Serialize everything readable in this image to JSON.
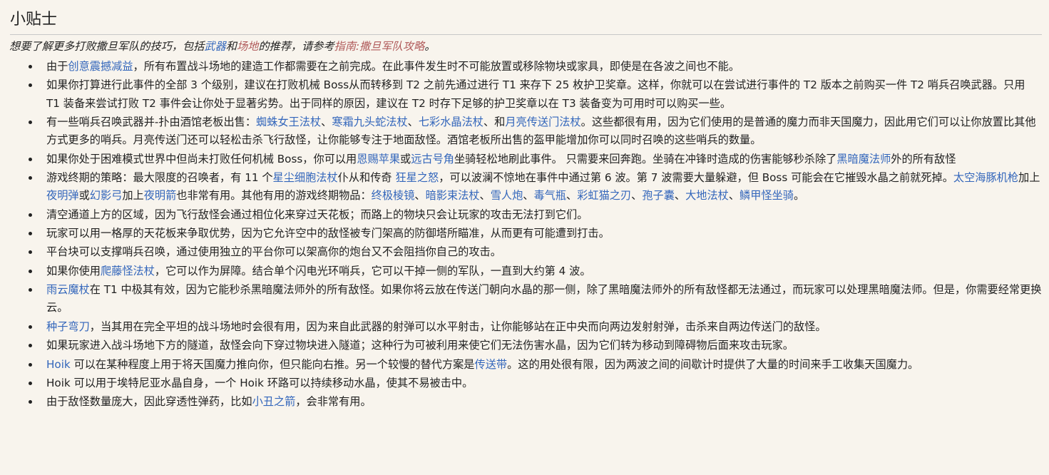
{
  "section": {
    "title": "小贴士"
  },
  "hatnote": {
    "prefix": "想要了解更多打败撒旦军队的技巧，包括",
    "link_weapons": "武器",
    "and": "和",
    "link_arenas": "场地",
    "middle": "的推荐，请参考",
    "link_guide": "指南:撒旦军队攻略",
    "suffix": "。"
  },
  "tips": [
    {
      "parts": [
        {
          "t": "由于"
        },
        {
          "t": "创意震撼减益",
          "link": true
        },
        {
          "t": "，所有布置战斗场地的建造工作都需要在之前完成。在此事件发生时不可能放置或移除物块或家具，即使是在各波之间也不能。"
        }
      ]
    },
    {
      "parts": [
        {
          "t": "如果你打算进行此事件的全部 3 个级别，建议在打败机械 Boss从而转移到 T2 之前先通过进行 T1 来存下 25 枚护卫奖章。这样，你就可以在尝试进行事件的 T2 版本之前购买一件 T2 哨兵召唤武器。只用 T1 装备来尝试打败 T2 事件会让你处于显著劣势。出于同样的原因，建议在 T2 时存下足够的护卫奖章以在 T3 装备变为可用时可以购买一些。"
        }
      ]
    },
    {
      "parts": [
        {
          "t": "有一些哨兵召唤武器并-扑由酒馆老板出售："
        },
        {
          "t": "蜘蛛女王法杖",
          "link": true
        },
        {
          "t": "、"
        },
        {
          "t": "寒霜九头蛇法杖",
          "link": true
        },
        {
          "t": "、"
        },
        {
          "t": "七彩水晶法杖",
          "link": true
        },
        {
          "t": "、和"
        },
        {
          "t": "月亮传送门法杖",
          "link": true
        },
        {
          "t": "。这些都很有用，因为它们使用的是普通的魔力而非天国魔力，因此用它们可以让你放置比其他方式更多的哨兵。月亮传送门还可以轻松击杀飞行敌怪，让你能够专注于地面敌怪。酒馆老板所出售的盔甲能增加你可以同时召唤的这些哨兵的数量。"
        }
      ]
    },
    {
      "parts": [
        {
          "t": "如果你处于困难模式世界中但尚未打败任何机械 Boss，你可以用"
        },
        {
          "t": "恩赐苹果",
          "link": true
        },
        {
          "t": "或"
        },
        {
          "t": "远古号角",
          "link": true
        },
        {
          "t": "坐骑轻松地刷此事件。 只需要来回奔跑。坐骑在冲锋时造成的伤害能够秒杀除了"
        },
        {
          "t": "黑暗魔法师",
          "link": true
        },
        {
          "t": "外的所有敌怪"
        }
      ]
    },
    {
      "parts": [
        {
          "t": "游戏终期的策略：最大限度的召唤者，有 11 个"
        },
        {
          "t": "星尘细胞法杖",
          "link": true
        },
        {
          "t": "仆从和传奇 "
        },
        {
          "t": "狂星之怒",
          "link": true
        },
        {
          "t": "，可以波澜不惊地在事件中通过第 6 波。第 7 波需要大量躲避，但 Boss 可能会在它摧毁水晶之前就死掉。"
        },
        {
          "t": "太空海豚机枪",
          "link": true
        },
        {
          "t": "加上"
        },
        {
          "t": "夜明弹",
          "link": true
        },
        {
          "t": "或"
        },
        {
          "t": "幻影弓",
          "link": true
        },
        {
          "t": "加上"
        },
        {
          "t": "夜明箭",
          "link": true
        },
        {
          "t": "也非常有用。其他有用的游戏终期物品："
        },
        {
          "t": "终极棱镜",
          "link": true
        },
        {
          "t": "、"
        },
        {
          "t": "暗影束法杖",
          "link": true
        },
        {
          "t": "、"
        },
        {
          "t": "雪人炮",
          "link": true
        },
        {
          "t": "、"
        },
        {
          "t": "毒气瓶",
          "link": true
        },
        {
          "t": "、"
        },
        {
          "t": "彩虹猫之刃",
          "link": true
        },
        {
          "t": "、"
        },
        {
          "t": "孢子囊",
          "link": true
        },
        {
          "t": "、"
        },
        {
          "t": "大地法杖",
          "link": true
        },
        {
          "t": "、"
        },
        {
          "t": "鳞甲怪坐骑",
          "link": true
        },
        {
          "t": "。"
        }
      ]
    },
    {
      "parts": [
        {
          "t": "清空通道上方的区域，因为飞行敌怪会通过相位化来穿过天花板；而路上的物块只会让玩家的攻击无法打到它们。"
        }
      ]
    },
    {
      "parts": [
        {
          "t": "玩家可以用一格厚的天花板来争取优势，因为它允许空中的敌怪被专门架高的防御塔所瞄准，从而更有可能遭到打击。"
        }
      ]
    },
    {
      "parts": [
        {
          "t": "平台块可以支撑哨兵召唤，通过使用独立的平台你可以架高你的炮台又不会阻挡你自己的攻击。"
        }
      ]
    },
    {
      "parts": [
        {
          "t": "如果你使用"
        },
        {
          "t": "爬藤怪法杖",
          "link": true
        },
        {
          "t": "，它可以作为屏障。结合单个闪电光环哨兵，它可以干掉一侧的军队，一直到大约第 4 波。"
        }
      ]
    },
    {
      "parts": [
        {
          "t": "雨云魔杖",
          "link": true
        },
        {
          "t": "在 T1 中极其有效，因为它能秒杀黑暗魔法师外的所有敌怪。如果你将云放在传送门朝向水晶的那一侧，除了黑暗魔法师外的所有敌怪都无法通过，而玩家可以处理黑暗魔法师。但是，你需要经常更换云。"
        }
      ]
    },
    {
      "parts": [
        {
          "t": "种子弯刀",
          "link": true
        },
        {
          "t": "，当其用在完全平坦的战斗场地时会很有用，因为来自此武器的射弹可以水平射击，让你能够站在正中央而向两边发射射弹，击杀来自两边传送门的敌怪。"
        }
      ]
    },
    {
      "parts": [
        {
          "t": "如果玩家进入战斗场地下方的隧道，敌怪会向下穿过物块进入隧道；这种行为可被利用来使它们无法伤害水晶，因为它们转为移动到障碍物后面来攻击玩家。"
        }
      ]
    },
    {
      "parts": [
        {
          "t": "Hoik",
          "link": true
        },
        {
          "t": " 可以在某种程度上用于将天国魔力推向你，但只能向右推。另一个较慢的替代方案是"
        },
        {
          "t": "传送带",
          "link": true
        },
        {
          "t": "。这的用处很有限，因为两波之间的间歇计时提供了大量的时间来手工收集天国魔力。"
        }
      ]
    },
    {
      "parts": [
        {
          "t": "Hoik 可以用于埃特尼亚水晶自身，一个 Hoik 环路可以持续移动水晶，使其不易被击中。"
        }
      ]
    },
    {
      "parts": [
        {
          "t": "由于敌怪数量庞大，因此穿透性弹药，比如"
        },
        {
          "t": "小丑之箭",
          "link": true
        },
        {
          "t": "，会非常有用。"
        }
      ]
    }
  ]
}
